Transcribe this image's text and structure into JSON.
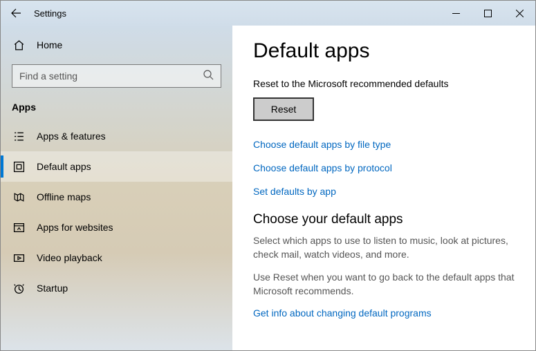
{
  "window": {
    "title": "Settings"
  },
  "sidebar": {
    "home": "Home",
    "searchPlaceholder": "Find a setting",
    "category": "Apps",
    "items": [
      {
        "label": "Apps & features",
        "icon": "list-icon",
        "selected": false
      },
      {
        "label": "Default apps",
        "icon": "defaults-icon",
        "selected": true
      },
      {
        "label": "Offline maps",
        "icon": "map-icon",
        "selected": false
      },
      {
        "label": "Apps for websites",
        "icon": "websites-icon",
        "selected": false
      },
      {
        "label": "Video playback",
        "icon": "video-icon",
        "selected": false
      },
      {
        "label": "Startup",
        "icon": "startup-icon",
        "selected": false
      }
    ]
  },
  "main": {
    "heading": "Default apps",
    "resetDesc": "Reset to the Microsoft recommended defaults",
    "resetButton": "Reset",
    "links": [
      "Choose default apps by file type",
      "Choose default apps by protocol",
      "Set defaults by app"
    ],
    "subHeading": "Choose your default apps",
    "desc1": "Select which apps to use to listen to music, look at pictures, check mail, watch videos, and more.",
    "desc2": "Use Reset when you want to go back to the default apps that Microsoft recommends.",
    "infoLink": "Get info about changing default programs"
  }
}
